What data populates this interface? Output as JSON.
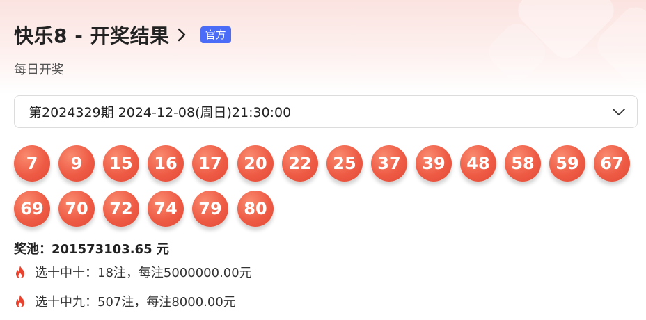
{
  "header": {
    "title": "快乐8 - 开奖结果",
    "badge": "官方",
    "subtitle": "每日开奖"
  },
  "draw_select": {
    "value": "第2024329期 2024-12-08(周日)21:30:00"
  },
  "balls": [
    "7",
    "9",
    "15",
    "16",
    "17",
    "20",
    "22",
    "25",
    "37",
    "39",
    "48",
    "58",
    "59",
    "67",
    "69",
    "70",
    "72",
    "74",
    "79",
    "80"
  ],
  "jackpot": "奖池：201573103.65 元",
  "prizes": [
    "选十中十：18注，每注5000000.00元",
    "选十中九：507注，每注8000.00元"
  ],
  "colors": {
    "ball": "#ee5b45",
    "badge": "#4a6cf7",
    "fire": "#e8432e"
  }
}
